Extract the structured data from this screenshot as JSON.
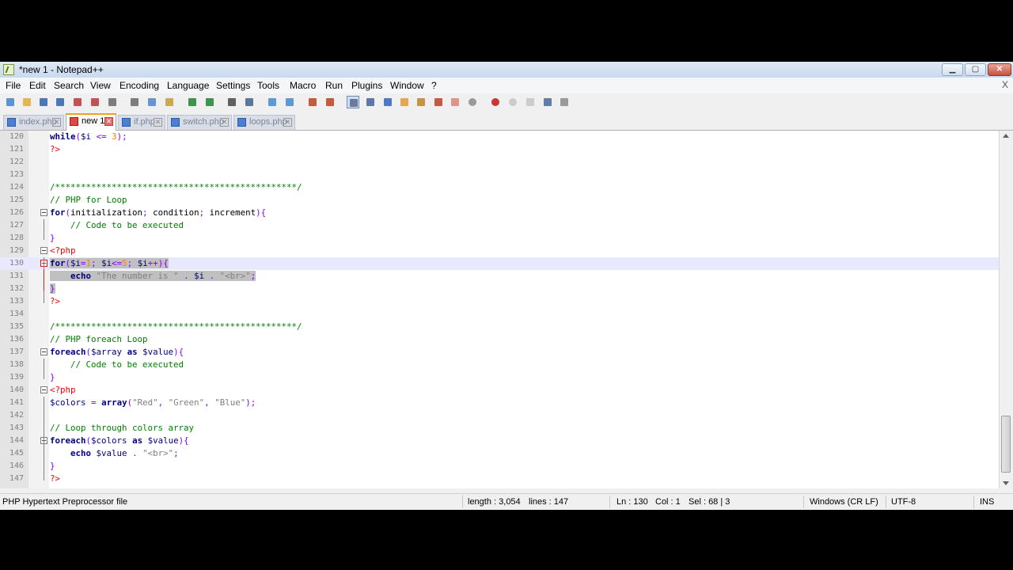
{
  "window": {
    "title": "*new 1 - Notepad++"
  },
  "menu": [
    "File",
    "Edit",
    "Search",
    "View",
    "Encoding",
    "Language",
    "Settings",
    "Tools",
    "Macro",
    "Run",
    "Plugins",
    "Window",
    "?"
  ],
  "menu_close": "X",
  "tabs": [
    {
      "label": "index.php"
    },
    {
      "label": "new 1"
    },
    {
      "label": "if.php"
    },
    {
      "label": "switch.php"
    },
    {
      "label": "loops.php"
    }
  ],
  "toolbar_icons": [
    "new-file-icon",
    "open-file-icon",
    "save-icon",
    "save-all-icon",
    "close-icon",
    "close-all-icon",
    "print-icon",
    "cut-icon",
    "copy-icon",
    "paste-icon",
    "undo-icon",
    "redo-icon",
    "find-icon",
    "replace-icon",
    "zoom-in-icon",
    "zoom-out-icon",
    "sync-vertical-icon",
    "sync-horizontal-icon",
    "word-wrap-icon",
    "show-all-chars-icon",
    "indent-guide-icon",
    "user-define-lang-icon",
    "doc-map-icon",
    "function-list-icon",
    "folder-workspace-icon",
    "monitor-icon",
    "record-macro-icon",
    "stop-record-icon",
    "play-macro-icon",
    "run-macro-multiple-icon",
    "save-macro-icon"
  ],
  "editor": {
    "lines": [
      {
        "n": "120",
        "text": "while($i <= 3);"
      },
      {
        "n": "121",
        "text": "?>"
      },
      {
        "n": "122",
        "text": ""
      },
      {
        "n": "123",
        "text": ""
      },
      {
        "n": "124",
        "text": "/***********************************************/"
      },
      {
        "n": "125",
        "text": "// PHP for Loop"
      },
      {
        "n": "126",
        "text": "for(initialization; condition; increment){"
      },
      {
        "n": "127",
        "text": "    // Code to be executed"
      },
      {
        "n": "128",
        "text": "}"
      },
      {
        "n": "129",
        "text": "<?php"
      },
      {
        "n": "130",
        "text": "for($i=1; $i<=5; $i++){"
      },
      {
        "n": "131",
        "text": "    echo \"The number is \" . $i . \"<br>\";"
      },
      {
        "n": "132",
        "text": "}"
      },
      {
        "n": "133",
        "text": "?>"
      },
      {
        "n": "134",
        "text": ""
      },
      {
        "n": "135",
        "text": "/***********************************************/"
      },
      {
        "n": "136",
        "text": "// PHP foreach Loop"
      },
      {
        "n": "137",
        "text": "foreach($array as $value){"
      },
      {
        "n": "138",
        "text": "    // Code to be executed"
      },
      {
        "n": "139",
        "text": "}"
      },
      {
        "n": "140",
        "text": "<?php"
      },
      {
        "n": "141",
        "text": "$colors = array(\"Red\", \"Green\", \"Blue\");"
      },
      {
        "n": "142",
        "text": ""
      },
      {
        "n": "143",
        "text": "// Loop through colors array"
      },
      {
        "n": "144",
        "text": "foreach($colors as $value){"
      },
      {
        "n": "145",
        "text": "    echo $value . \"<br>\";"
      },
      {
        "n": "146",
        "text": "}"
      },
      {
        "n": "147",
        "text": "?>"
      }
    ]
  },
  "status": {
    "file_type": "PHP Hypertext Preprocessor file",
    "length": "length : 3,054",
    "lines": "lines : 147",
    "ln": "Ln : 130",
    "col": "Col : 1",
    "sel": "Sel : 68 | 3",
    "eol": "Windows (CR LF)",
    "encoding": "UTF-8",
    "mode": "INS"
  },
  "colors": {
    "keyword": "#000080",
    "comment": "#008000",
    "string": "#808080",
    "number": "#ff8000",
    "operator": "#8000ff",
    "php_tag": "#ff0000",
    "selection": "#c0c0c0"
  }
}
